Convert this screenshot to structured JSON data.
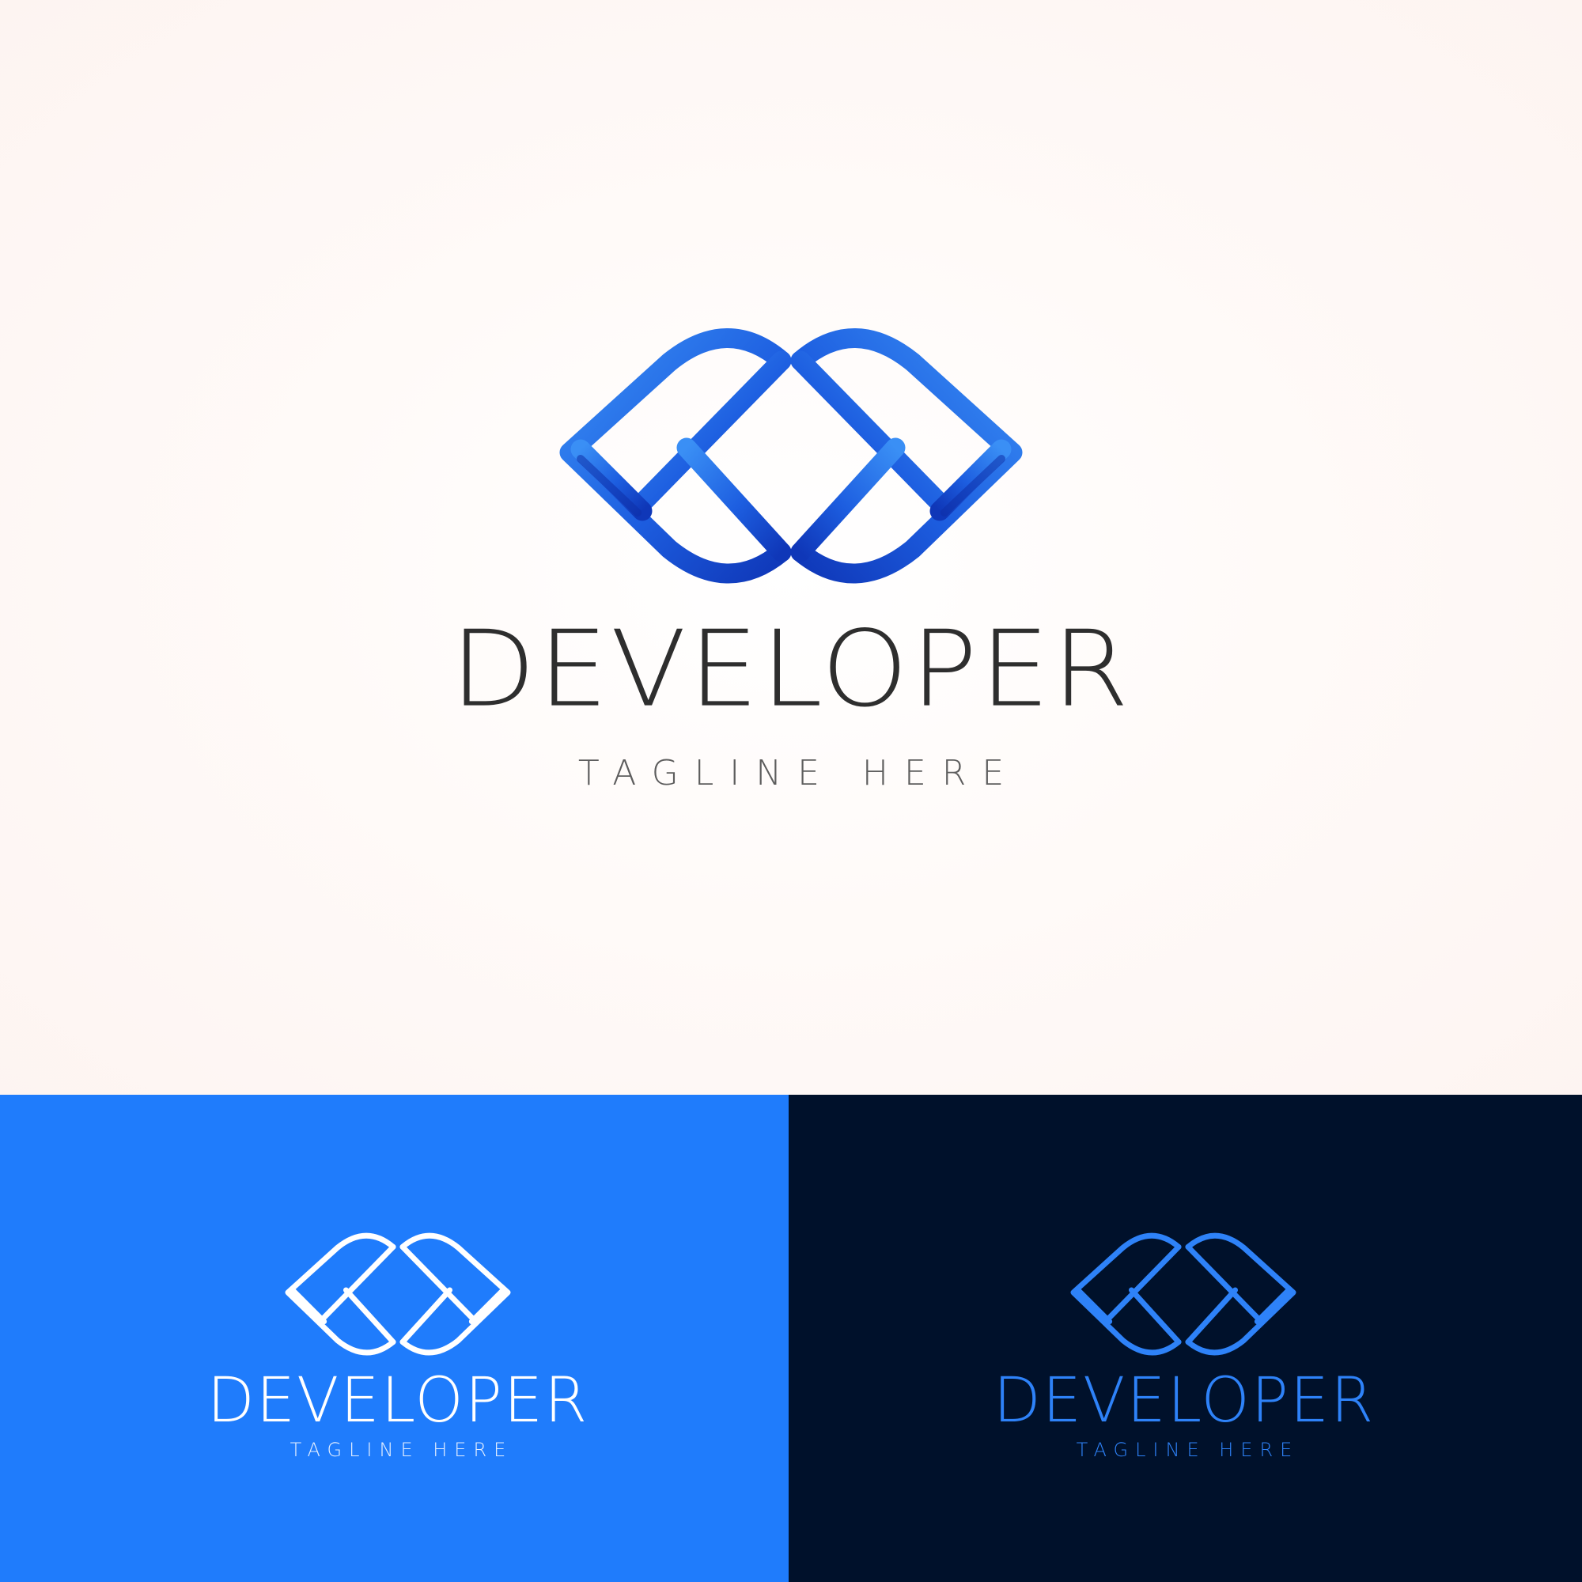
{
  "hero": {
    "background": "#fdf5f2",
    "wordmark": "DEVELOPER",
    "tagline": "TAGLINE HERE",
    "mark_icon": "double-chevron-logo-icon",
    "mark_colors": [
      "#2f86f2",
      "#1a4fd6",
      "#0f2fa8"
    ],
    "text_color": "#2e2e2e"
  },
  "panel_blue": {
    "background": "#1f7cfc",
    "wordmark": "DEVELOPER",
    "tagline": "TAGLINE HERE",
    "mark_icon": "double-chevron-logo-icon",
    "foreground": "#ffffff"
  },
  "panel_navy": {
    "background": "#00112b",
    "wordmark": "DEVELOPER",
    "tagline": "TAGLINE HERE",
    "mark_icon": "double-chevron-logo-icon",
    "foreground": "#2e82f8"
  }
}
